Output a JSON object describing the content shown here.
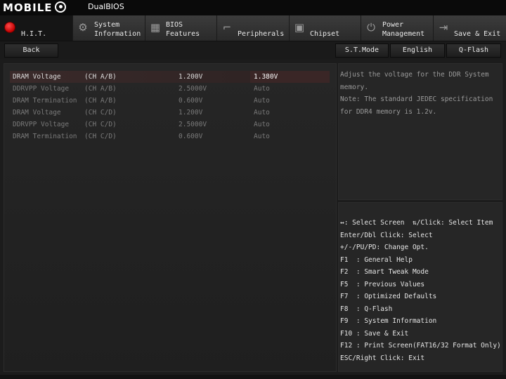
{
  "brand": {
    "logo": "MOBILE",
    "dualbios": "DualBIOS"
  },
  "tabs": [
    {
      "label": "H.I.T.",
      "icon": "hit-red-icon"
    },
    {
      "label": "System\nInformation",
      "icon": "gear-icon"
    },
    {
      "label": "BIOS\nFeatures",
      "icon": "bios-features-icon"
    },
    {
      "label": "Peripherals",
      "icon": "peripherals-icon"
    },
    {
      "label": "Chipset",
      "icon": "chipset-icon"
    },
    {
      "label": "Power\nManagement",
      "icon": "power-icon"
    },
    {
      "label": "Save & Exit",
      "icon": "exit-icon"
    }
  ],
  "toolbar": {
    "back": "Back",
    "st_mode": "S.T.Mode",
    "language": "English",
    "qflash": "Q-Flash"
  },
  "settings": [
    {
      "name": "DRAM Voltage",
      "channel": "(CH A/B)",
      "current": "1.200V",
      "value": "1.380V",
      "selected": true,
      "dim": false
    },
    {
      "name": "DDRVPP Voltage",
      "channel": "(CH A/B)",
      "current": "2.5000V",
      "value": "Auto",
      "selected": false,
      "dim": true
    },
    {
      "name": "DRAM Termination",
      "channel": "(CH A/B)",
      "current": "0.600V",
      "value": "Auto",
      "selected": false,
      "dim": true
    },
    {
      "name": "DRAM Voltage",
      "channel": "(CH C/D)",
      "current": "1.200V",
      "value": "Auto",
      "selected": false,
      "dim": true
    },
    {
      "name": "DDRVPP Voltage",
      "channel": "(CH C/D)",
      "current": "2.5000V",
      "value": "Auto",
      "selected": false,
      "dim": true
    },
    {
      "name": "DRAM Termination",
      "channel": "(CH C/D)",
      "current": "0.600V",
      "value": "Auto",
      "selected": false,
      "dim": true
    }
  ],
  "help": [
    "Adjust the voltage for the DDR System",
    "memory.",
    "Note: The standard JEDEC specification",
    "for DDR4 memory is 1.2v."
  ],
  "keys": [
    "↔: Select Screen  ⇅/Click: Select Item",
    "Enter/Dbl Click: Select",
    "+/-/PU/PD: Change Opt.",
    "F1  : General Help",
    "F2  : Smart Tweak Mode",
    "F5  : Previous Values",
    "F7  : Optimized Defaults",
    "F8  : Q-Flash",
    "F9  : System Information",
    "F10 : Save & Exit",
    "F12 : Print Screen(FAT16/32 Format Only)",
    "ESC/Right Click: Exit"
  ],
  "colors": {
    "accent_red": "#cc0000",
    "selected_row": "#3a2a2a"
  }
}
